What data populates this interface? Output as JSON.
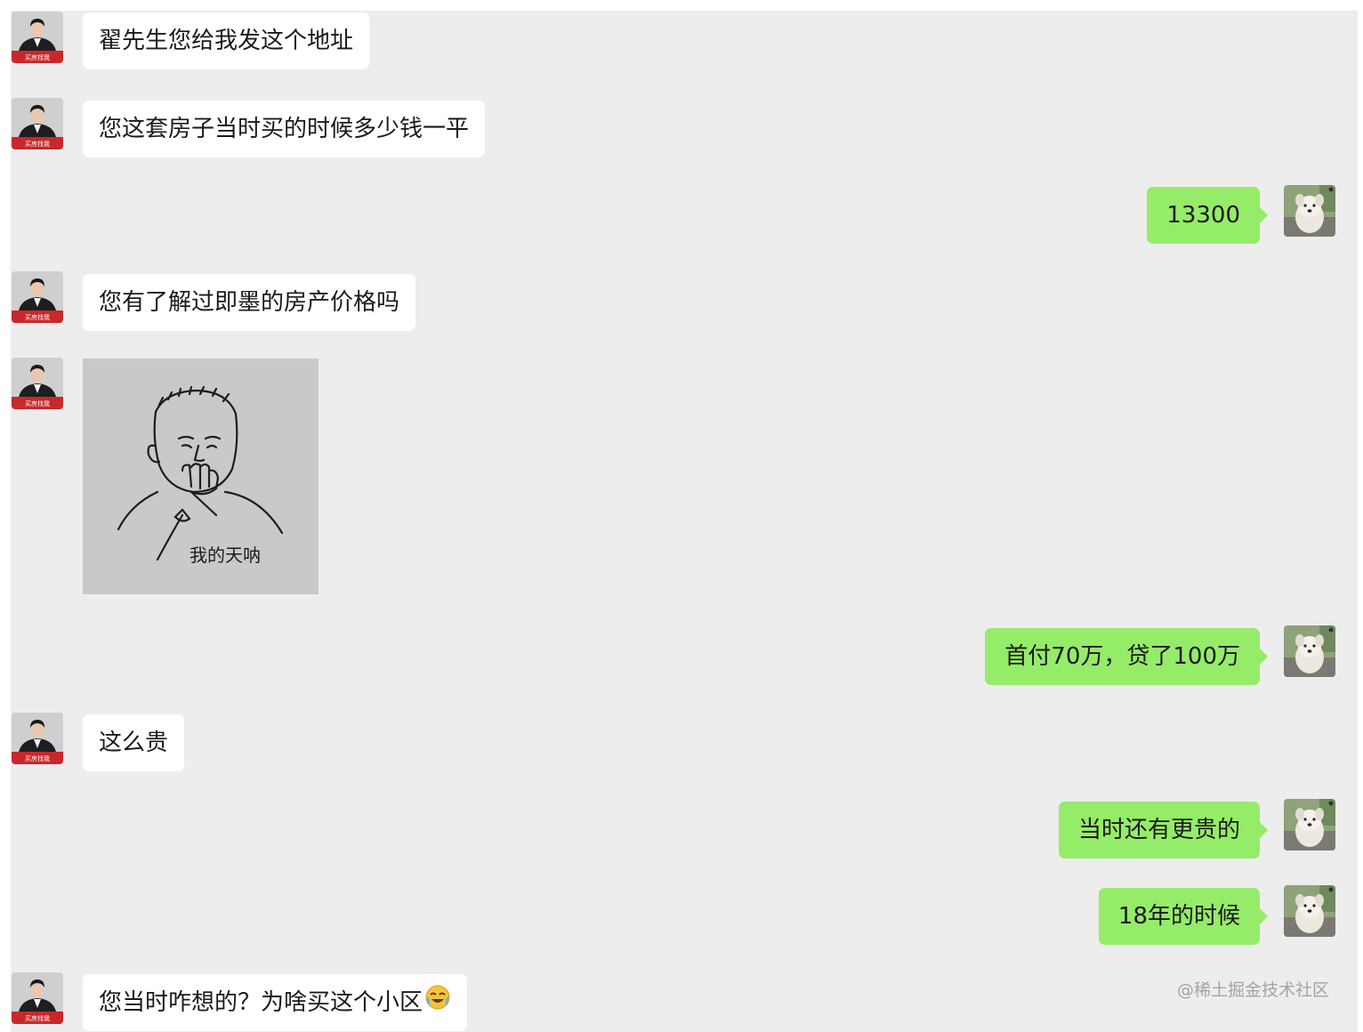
{
  "messages": [
    {
      "side": "in",
      "text": "翟先生您给我发这个地址"
    },
    {
      "side": "in",
      "text": "您这套房子当时买的时候多少钱一平"
    },
    {
      "side": "out",
      "text": "13300"
    },
    {
      "side": "in",
      "text": "您有了解过即墨的房产价格吗"
    },
    {
      "side": "in",
      "type": "sticker",
      "sticker_caption": "我的天呐"
    },
    {
      "side": "out",
      "text": "首付70万，贷了100万"
    },
    {
      "side": "in",
      "text": "这么贵"
    },
    {
      "side": "out",
      "text": "当时还有更贵的"
    },
    {
      "side": "out",
      "text": "18年的时候"
    },
    {
      "side": "in",
      "text": "您当时咋想的？为啥买这个小区",
      "emoji": "laughing-crying-emoji"
    }
  ],
  "avatars": {
    "agent_badge": "买房找我",
    "agent_icon": "agent-avatar-icon",
    "user_icon": "dog-avatar-icon"
  },
  "watermark": "@稀土掘金技术社区",
  "colors": {
    "chat_background": "#ededed",
    "incoming_bubble": "#ffffff",
    "outgoing_bubble": "#95ec69",
    "agent_badge_red": "#c8282b"
  }
}
